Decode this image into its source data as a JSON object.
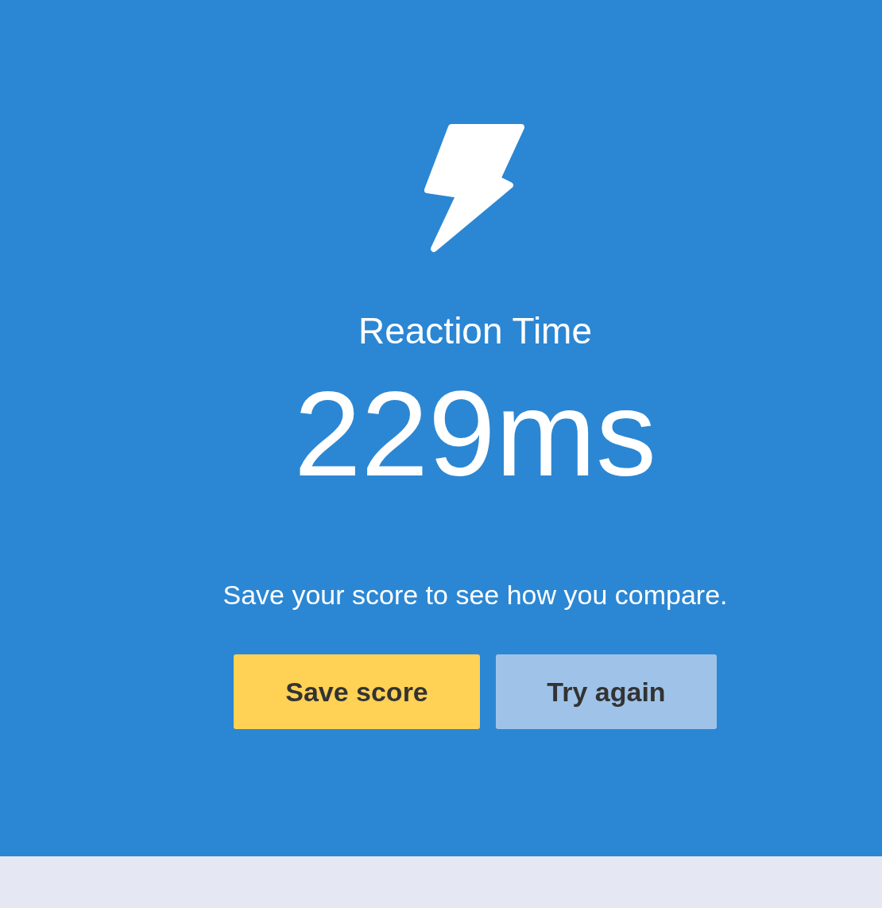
{
  "title": "Reaction Time",
  "result": "229ms",
  "message": "Save your score to see how you compare.",
  "buttons": [
    {
      "label": "Save score",
      "kind": "primary"
    },
    {
      "label": "Try again",
      "kind": "secondary"
    }
  ]
}
